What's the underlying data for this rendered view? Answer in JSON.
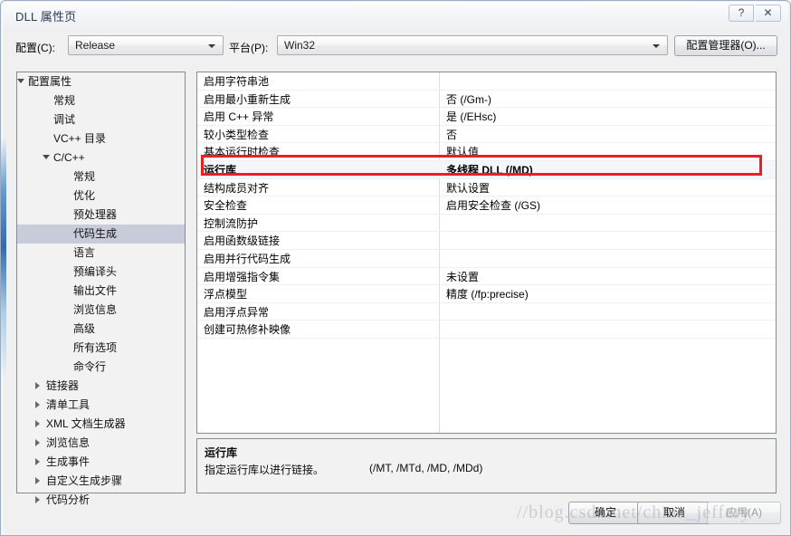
{
  "window": {
    "title": "DLL 属性页",
    "help_button": "?",
    "close_button": "✕"
  },
  "config_bar": {
    "config_label": "配置(C):",
    "config_value": "Release",
    "platform_label": "平台(P):",
    "platform_value": "Win32",
    "config_manager_button": "配置管理器(O)..."
  },
  "tree": {
    "items": [
      {
        "label": "配置属性",
        "indent": 12,
        "twisty": "open",
        "selected": false
      },
      {
        "label": "常规",
        "indent": 40,
        "twisty": "none",
        "selected": false
      },
      {
        "label": "调试",
        "indent": 40,
        "twisty": "none",
        "selected": false
      },
      {
        "label": "VC++ 目录",
        "indent": 40,
        "twisty": "none",
        "selected": false
      },
      {
        "label": "C/C++",
        "indent": 40,
        "twisty": "open",
        "selected": false
      },
      {
        "label": "常规",
        "indent": 62,
        "twisty": "none",
        "selected": false
      },
      {
        "label": "优化",
        "indent": 62,
        "twisty": "none",
        "selected": false
      },
      {
        "label": "预处理器",
        "indent": 62,
        "twisty": "none",
        "selected": false
      },
      {
        "label": "代码生成",
        "indent": 62,
        "twisty": "none",
        "selected": true
      },
      {
        "label": "语言",
        "indent": 62,
        "twisty": "none",
        "selected": false
      },
      {
        "label": "预编译头",
        "indent": 62,
        "twisty": "none",
        "selected": false
      },
      {
        "label": "输出文件",
        "indent": 62,
        "twisty": "none",
        "selected": false
      },
      {
        "label": "浏览信息",
        "indent": 62,
        "twisty": "none",
        "selected": false
      },
      {
        "label": "高级",
        "indent": 62,
        "twisty": "none",
        "selected": false
      },
      {
        "label": "所有选项",
        "indent": 62,
        "twisty": "none",
        "selected": false
      },
      {
        "label": "命令行",
        "indent": 62,
        "twisty": "none",
        "selected": false
      },
      {
        "label": "链接器",
        "indent": 32,
        "twisty": "closed",
        "selected": false
      },
      {
        "label": "清单工具",
        "indent": 32,
        "twisty": "closed",
        "selected": false
      },
      {
        "label": "XML 文档生成器",
        "indent": 32,
        "twisty": "closed",
        "selected": false
      },
      {
        "label": "浏览信息",
        "indent": 32,
        "twisty": "closed",
        "selected": false
      },
      {
        "label": "生成事件",
        "indent": 32,
        "twisty": "closed",
        "selected": false
      },
      {
        "label": "自定义生成步骤",
        "indent": 32,
        "twisty": "closed",
        "selected": false
      },
      {
        "label": "代码分析",
        "indent": 32,
        "twisty": "closed",
        "selected": false
      }
    ]
  },
  "grid": {
    "rows": [
      {
        "name": "启用字符串池",
        "value": "",
        "selected": false
      },
      {
        "name": "启用最小重新生成",
        "value": "否 (/Gm-)",
        "selected": false
      },
      {
        "name": "启用 C++ 异常",
        "value": "是 (/EHsc)",
        "selected": false
      },
      {
        "name": "较小类型检查",
        "value": "否",
        "selected": false
      },
      {
        "name": "基本运行时检查",
        "value": "默认值",
        "selected": false
      },
      {
        "name": "运行库",
        "value": "多线程 DLL (/MD)",
        "selected": true
      },
      {
        "name": "结构成员对齐",
        "value": "默认设置",
        "selected": false
      },
      {
        "name": "安全检查",
        "value": "启用安全检查 (/GS)",
        "selected": false
      },
      {
        "name": "控制流防护",
        "value": "",
        "selected": false
      },
      {
        "name": "启用函数级链接",
        "value": "",
        "selected": false
      },
      {
        "name": "启用并行代码生成",
        "value": "",
        "selected": false
      },
      {
        "name": "启用增强指令集",
        "value": "未设置",
        "selected": false
      },
      {
        "name": "浮点模型",
        "value": "精度 (/fp:precise)",
        "selected": false
      },
      {
        "name": "启用浮点异常",
        "value": "",
        "selected": false
      },
      {
        "name": "创建可热修补映像",
        "value": "",
        "selected": false
      }
    ],
    "highlight_color": "#ee1c25"
  },
  "description": {
    "title": "运行库",
    "body": "指定运行库以进行链接。",
    "flags": "(/MT, /MTd, /MD, /MDd)"
  },
  "footer": {
    "ok": "确定",
    "cancel": "取消",
    "apply": "应用(A)"
  },
  "watermark": {
    "text": "//blog.csdn.net/china_jeffery"
  }
}
